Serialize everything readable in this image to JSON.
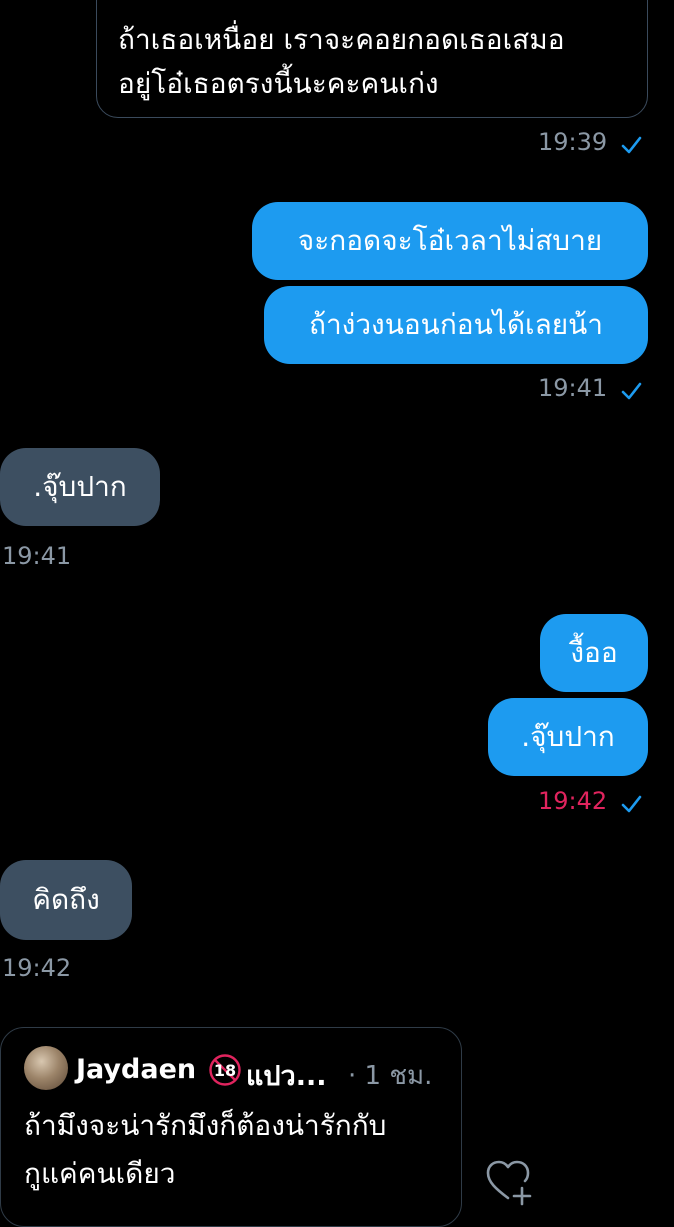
{
  "top_message": {
    "text": "ถ้าเธอเหนื่อย เราจะคอยกอดเธอเสมอ\nอยู่โอ๋เธอตรงนี้นะคะคนเก่ง",
    "time": "19:39"
  },
  "messages": [
    {
      "side": "out",
      "text": "จะกอดจะโอ๋เวลาไม่สบาย"
    },
    {
      "side": "out",
      "text": "ถ้าง่วงนอนก่อนได้เลยน้า",
      "time": "19:41"
    },
    {
      "side": "in",
      "text": ".จุ๊บปาก",
      "time": "19:41"
    },
    {
      "side": "out",
      "text": "งื้ออ"
    },
    {
      "side": "out",
      "text": ".จุ๊บปาก",
      "time": "19:42"
    },
    {
      "side": "in",
      "text": "คิดถึง",
      "time": "19:42"
    }
  ],
  "tweet": {
    "name": "Jaydaen",
    "name_suffix": "แปว...",
    "time": "· 1 ชม.",
    "text": "ถ้ามึงจะน่ารักมึงก็ต้องน่ารักกับ\nกูแค่คนเดียว",
    "badge": "18"
  },
  "colors": {
    "outgoing_bubble": "#1d9bf0",
    "incoming_bubble": "#3d4f61",
    "timestamp": "#8b98a5",
    "timestamp_highlight": "#e0245e",
    "read_check": "#1d9bf0"
  },
  "icons": {
    "read_receipt": "checkmark-icon",
    "react": "heart-add-icon",
    "badge": "age-restricted-18-icon"
  }
}
